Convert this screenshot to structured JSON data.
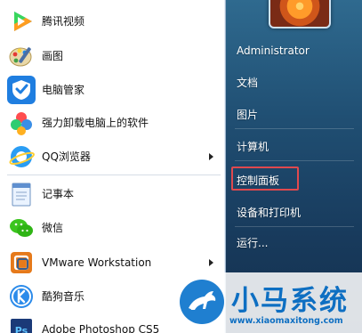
{
  "start_menu": {
    "programs": [
      {
        "label": "腾讯视频",
        "icon": "tencent-video-icon",
        "has_submenu": false
      },
      {
        "label": "画图",
        "icon": "paint-icon",
        "has_submenu": false
      },
      {
        "label": "电脑管家",
        "icon": "pc-manager-icon",
        "has_submenu": false
      },
      {
        "label": "强力卸载电脑上的软件",
        "icon": "uninstaller-icon",
        "has_submenu": false
      },
      {
        "label": "QQ浏览器",
        "icon": "qq-browser-icon",
        "has_submenu": true
      },
      {
        "label": "记事本",
        "icon": "notepad-icon",
        "has_submenu": false
      },
      {
        "label": "微信",
        "icon": "wechat-icon",
        "has_submenu": false
      },
      {
        "label": "VMware Workstation",
        "icon": "vmware-icon",
        "has_submenu": true
      },
      {
        "label": "酷狗音乐",
        "icon": "kugou-icon",
        "has_submenu": false
      },
      {
        "label": "Adobe Photoshop CS5",
        "icon": "photoshop-icon",
        "has_submenu": false
      }
    ],
    "right_pane": {
      "user": "Administrator",
      "items": [
        "文档",
        "图片",
        "计算机",
        "控制面板",
        "设备和打印机",
        "运行..."
      ],
      "highlighted": "控制面板"
    }
  },
  "watermark": {
    "title": "小马系统",
    "url": "www.xiaomaxitong.com"
  },
  "colors": {
    "right_pane_top": "#2f6a8f",
    "right_pane_bottom": "#142f4d",
    "highlight_border": "#e0494e",
    "watermark_blue": "#0e6fc2"
  }
}
